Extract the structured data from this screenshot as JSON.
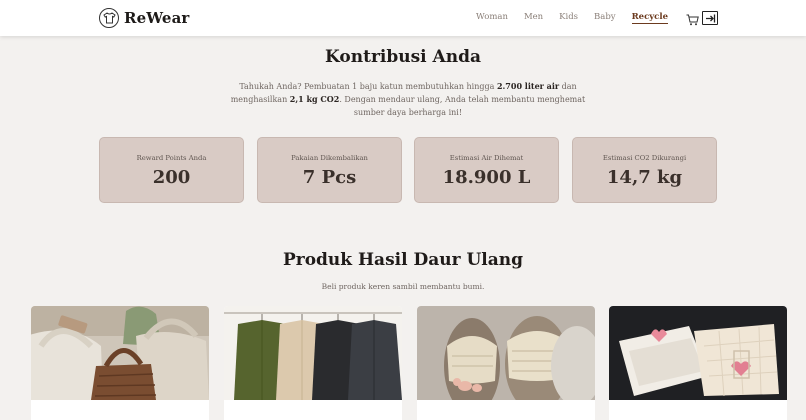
{
  "brand": {
    "name": "ReWear",
    "logo_icon": "tshirt-icon"
  },
  "nav": {
    "links": [
      "Woman",
      "Men",
      "Kids",
      "Baby",
      "Recycle"
    ],
    "active": "Recycle",
    "cart_icon": "cart-icon",
    "logout_icon": "logout-icon"
  },
  "contribution": {
    "title": "Kontribusi Anda",
    "intro_1": "Tahukah Anda? Pembuatan 1 baju katun membutuhkan hingga ",
    "intro_bold_1": "2.700 liter air",
    "intro_2": " dan menghasilkan ",
    "intro_bold_2": "2,1 kg CO2",
    "intro_3": ". Dengan mendaur ulang, Anda telah membantu menghemat sumber daya berharga ini!",
    "stats": [
      {
        "label": "Reward Points Anda",
        "value": "200"
      },
      {
        "label": "Pakaian Dikembalikan",
        "value": "7 Pcs"
      },
      {
        "label": "Estimasi Air Dihemat",
        "value": "18.900 L"
      },
      {
        "label": "Estimasi CO2 Dikurangi",
        "value": "14,7 kg"
      }
    ]
  },
  "products": {
    "title": "Produk Hasil Daur Ulang",
    "subtitle": "Beli produk keren sambil membantu bumi.",
    "items": [
      {
        "image": "knitted-bags-photo"
      },
      {
        "image": "shirts-on-rack-photo"
      },
      {
        "image": "woven-sandals-photo"
      },
      {
        "image": "quilted-wallets-photo"
      }
    ]
  },
  "colors": {
    "accent": "#6b3a1e",
    "card_bg": "#d9cbc5",
    "page_bg": "#f3f1ef"
  }
}
